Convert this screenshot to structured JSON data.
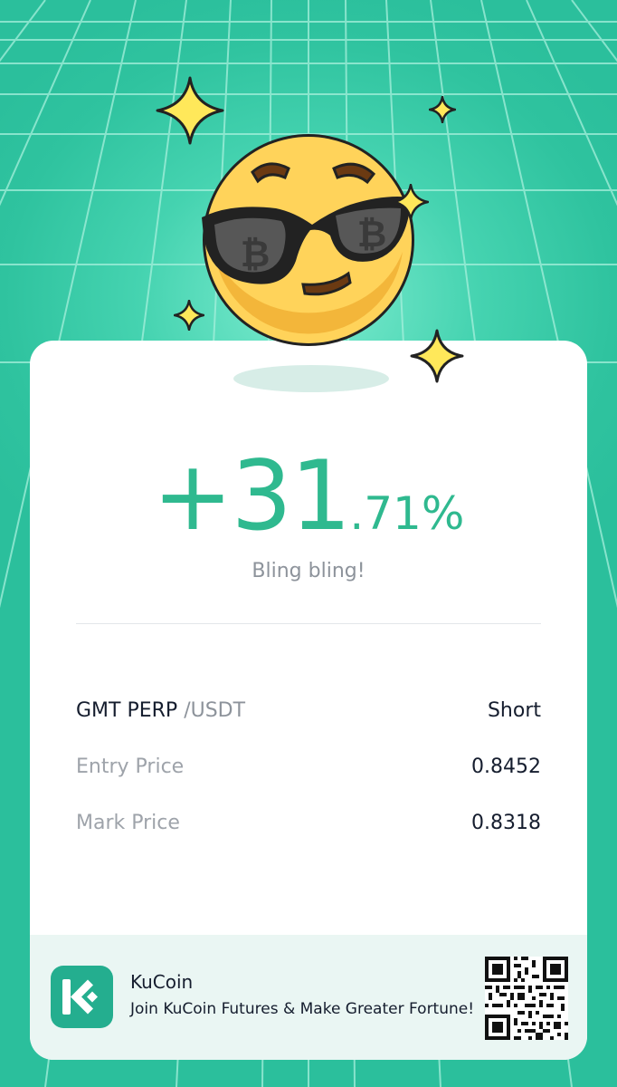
{
  "result": {
    "percent_integer": "+31",
    "percent_decimal": ".71%",
    "caption": "Bling bling!"
  },
  "position": {
    "pair_base": "GMT PERP ",
    "pair_quote": "/USDT",
    "side": "Short",
    "entry_label": "Entry Price",
    "entry_value": "0.8452",
    "mark_label": "Mark Price",
    "mark_value": "0.8318"
  },
  "footer": {
    "brand": "KuCoin",
    "slogan": "Join KuCoin Futures & Make Greater Fortune!"
  },
  "colors": {
    "accent": "#2fb98f",
    "background": "#2fc3a0",
    "logo": "#24ae8f"
  },
  "icons": [
    "smiley-sunglasses-icon",
    "sparkle-icon",
    "bitcoin-icon",
    "kucoin-logo-icon",
    "qr-code-icon"
  ]
}
